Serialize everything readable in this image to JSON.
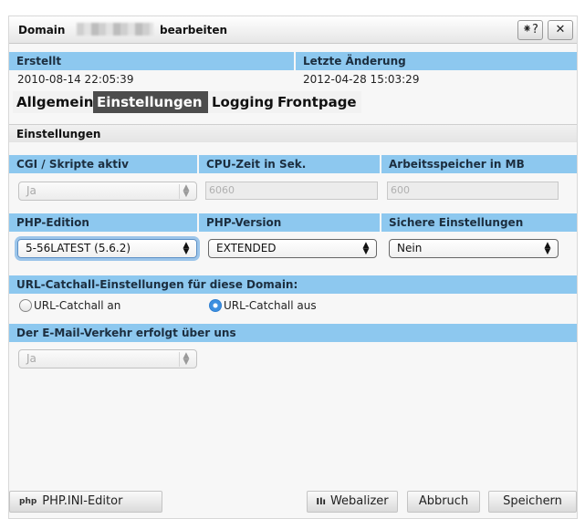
{
  "dialog": {
    "title_prefix": "Domain",
    "title_suffix": "bearbeiten",
    "help_icon": "pointer-question-icon",
    "help_glyph": "⁕?",
    "close_glyph": "✕"
  },
  "meta": {
    "created_label": "Erstellt",
    "created_value": "2010-08-14 22:05:39",
    "changed_label": "Letzte Änderung",
    "changed_value": "2012-04-28 15:03:29"
  },
  "tabs": [
    {
      "label": "Allgemein"
    },
    {
      "label": "Einstellungen"
    },
    {
      "label": "Logging"
    },
    {
      "label": "Frontpage"
    }
  ],
  "section_title": "Einstellungen",
  "row1": {
    "cgi_label": "CGI / Skripte aktiv",
    "cgi_value": "Ja",
    "cpu_label": "CPU-Zeit in Sek.",
    "cpu_value": "6060",
    "mem_label": "Arbeitsspeicher in MB",
    "mem_value": "600"
  },
  "row2": {
    "php_edition_label": "PHP-Edition",
    "php_edition_value": "5-56LATEST (5.6.2)",
    "php_version_label": "PHP-Version",
    "php_version_value": "EXTENDED",
    "secure_label": "Sichere Einstellungen",
    "secure_value": "Nein"
  },
  "catchall": {
    "label": "URL-Catchall-Einstellungen für diese Domain:",
    "option_on": "URL-Catchall an",
    "option_off": "URL-Catchall aus",
    "selected": "off"
  },
  "mail": {
    "label": "Der E-Mail-Verkehr erfolgt über uns",
    "value": "Ja"
  },
  "footer": {
    "phpini_icon_text": "php",
    "phpini_label": "PHP.INI-Editor",
    "webalizer_icon_text": "Ilı",
    "webalizer_label": "Webalizer",
    "cancel_label": "Abbruch",
    "save_label": "Speichern"
  },
  "colors": {
    "header_blue": "#8dc8ef",
    "tab_active": "#4d4d4d",
    "focus_ring": "#9cc5ea"
  }
}
